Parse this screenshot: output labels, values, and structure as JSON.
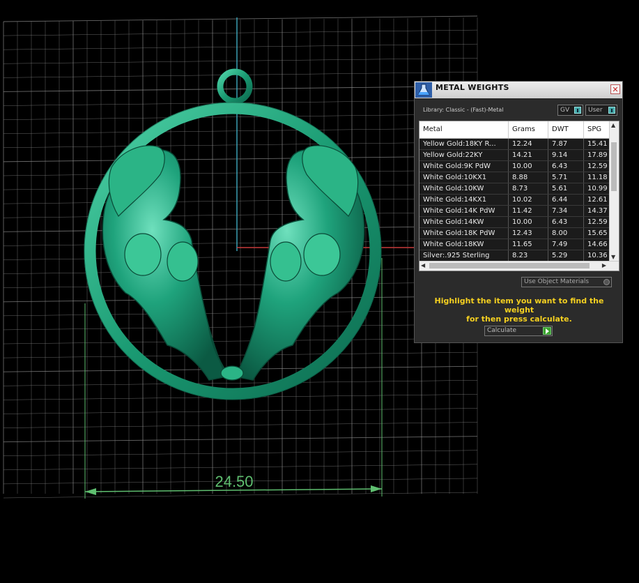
{
  "viewport": {
    "dimension_value": "24.50",
    "colors": {
      "grid": "#8a8a8a",
      "model": "#1f9d78",
      "dimension": "#5fbf70",
      "axis_y": "#3aa0b4",
      "axis_x": "#c83a3a"
    }
  },
  "panel": {
    "title": "METAL WEIGHTS",
    "close_glyph": "✕",
    "library_label": "Library: Classic - (Fast)-Metal",
    "toggles": {
      "gv_label": "GV",
      "user_label": "User"
    },
    "table": {
      "columns": [
        "Metal",
        "Grams",
        "DWT",
        "SPG"
      ],
      "rows": [
        [
          "Yellow Gold:18KY R...",
          "12.24",
          "7.87",
          "15.41"
        ],
        [
          "Yellow Gold:22KY",
          "14.21",
          "9.14",
          "17.89"
        ],
        [
          "White Gold:9K PdW",
          "10.00",
          "6.43",
          "12.59"
        ],
        [
          "White Gold:10KX1",
          "8.88",
          "5.71",
          "11.18"
        ],
        [
          "White Gold:10KW",
          "8.73",
          "5.61",
          "10.99"
        ],
        [
          "White Gold:14KX1",
          "10.02",
          "6.44",
          "12.61"
        ],
        [
          "White Gold:14K PdW",
          "11.42",
          "7.34",
          "14.37"
        ],
        [
          "White Gold:14KW",
          "10.00",
          "6.43",
          "12.59"
        ],
        [
          "White Gold:18K PdW",
          "12.43",
          "8.00",
          "15.65"
        ],
        [
          "White Gold:18KW",
          "11.65",
          "7.49",
          "14.66"
        ],
        [
          "Silver:.925 Sterling",
          "8.23",
          "5.29",
          "10.36"
        ]
      ]
    },
    "use_object_materials": "Use Object Materials",
    "instructions_line1": "Highlight the item you want to find the weight",
    "instructions_line2": "for then press calculate.",
    "calculate_label": "Calculate"
  }
}
